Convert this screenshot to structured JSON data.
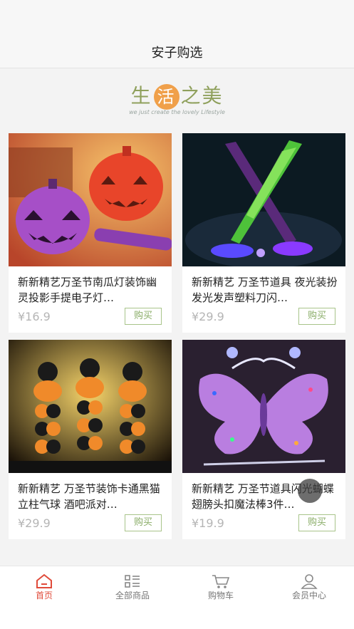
{
  "header": {
    "title": "安子购选"
  },
  "banner": {
    "brand_left": "生",
    "brand_mid": "活",
    "brand_right": "之美",
    "tagline": "we just create the lovely Lifestyle"
  },
  "products": [
    {
      "name": "新新精艺万圣节南瓜灯装饰幽灵投影手提电子灯…",
      "price": "¥16.9",
      "buy": "购买"
    },
    {
      "name": "新新精艺 万圣节道具 夜光装扮发光发声塑料刀闪…",
      "price": "¥29.9",
      "buy": "购买"
    },
    {
      "name": "新新精艺 万圣节装饰卡通黑猫立柱气球 酒吧派对…",
      "price": "¥29.9",
      "buy": "购买"
    },
    {
      "name": "新新精艺 万圣节道具闪光蝴蝶翅膀头扣魔法棒3件…",
      "price": "¥19.9",
      "buy": "购买"
    }
  ],
  "tabs": [
    {
      "label": "首页"
    },
    {
      "label": "全部商品"
    },
    {
      "label": "购物车"
    },
    {
      "label": "会员中心"
    }
  ],
  "colors": {
    "accent": "#e04b3a",
    "buy_border": "#a8c48a",
    "price": "#b5b5b5"
  }
}
